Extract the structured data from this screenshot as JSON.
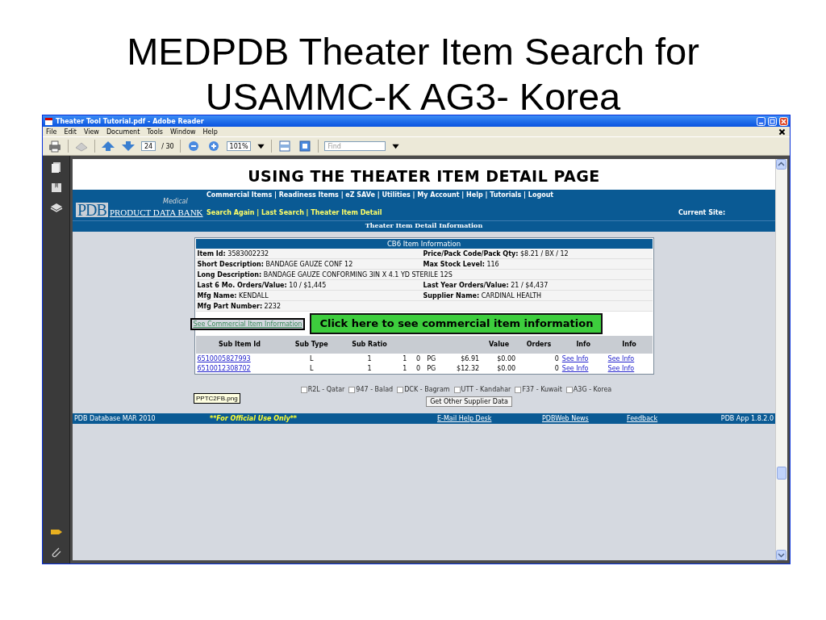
{
  "slide_title": "MEDPDB Theater Item Search for USAMMC-K AG3- Korea",
  "window": {
    "title": "Theater Tool Tutorial.pdf - Adobe Reader"
  },
  "menu": [
    "File",
    "Edit",
    "View",
    "Document",
    "Tools",
    "Window",
    "Help"
  ],
  "toolbar": {
    "page": "24",
    "page_count": "/ 30",
    "zoom": "101%",
    "find_placeholder": "Find"
  },
  "document": {
    "heading": "USING THE THEATER ITEM DETAIL PAGE",
    "logo": {
      "mark": "PDB",
      "name": "PRODUCT DATA BANK",
      "tag": "Medical"
    },
    "nav": "Commercial Items | Readiness Items | eZ SAVe | Utilities | My Account | Help | Tutorials | Logout",
    "subnav": "Search Again | Last Search | Theater Item Detail",
    "current_site": "Current Site:",
    "section_title": "Theater Item Detail Information",
    "info": {
      "title": "CB6 Item Information",
      "rows": [
        {
          "fields": [
            "**Item Id:** 3583002232",
            "**Price/Pack Code/Pack Qty:** $8.21 / BX / 12"
          ]
        },
        {
          "fields": [
            "**Short Description:** BANDAGE GAUZE CONF 12",
            "**Max Stock Level:** 116"
          ]
        },
        {
          "fields": [
            "**Long Description:** BANDAGE GAUZE CONFORMING 3IN X 4.1 YD STERILE 12S"
          ]
        },
        {
          "fields": [
            "**Last 6 Mo. Orders/Value:** 10 / $1,445",
            "**Last Year Orders/Value:** 21 / $4,437"
          ]
        },
        {
          "fields": [
            "**Mfg Name:** KENDALL",
            "**Supplier Name:** CARDINAL HEALTH"
          ]
        },
        {
          "fields": [
            "**Mfg Part Number:** 2232"
          ]
        }
      ],
      "link": "See Commercial Item Information",
      "columns": [
        {
          "label": "Sub Item Id",
          "kind": "link"
        },
        {
          "label": "Sub Type",
          "kind": "center"
        },
        {
          "label": "Sub Ratio",
          "kind": "center"
        },
        {
          "kind": "center"
        },
        {
          "kind": "number"
        },
        {
          "kind": "center"
        },
        {
          "kind": "number"
        },
        {
          "label": "Value",
          "kind": "number"
        },
        {
          "label": "Orders",
          "kind": "number"
        },
        {
          "label": "Info",
          "kind": "link"
        },
        {
          "label": "Info",
          "kind": "link"
        }
      ],
      "table_rows": [
        [
          "6510005827993",
          "L",
          "1",
          "1",
          "0",
          "PG",
          "$6.91",
          "$0.00",
          "0",
          "See Info",
          "See Info"
        ],
        [
          "6510012308702",
          "L",
          "1",
          "1",
          "0",
          "PG",
          "$12.32",
          "$0.00",
          "0",
          "See Info",
          "See Info"
        ]
      ]
    },
    "callout": "Click here to see commercial item information",
    "sites": [
      {
        "label": "R2L - Qatar",
        "checked": false
      },
      {
        "label": "947 - Balad",
        "checked": false
      },
      {
        "label": "DCK - Bagram",
        "checked": false
      },
      {
        "label": "UTT - Kandahar",
        "checked": false
      },
      {
        "label": "F37 - Kuwait",
        "checked": false
      },
      {
        "label": "A3G - Korea",
        "checked": false
      }
    ],
    "button": "Get Other Supplier Data",
    "tooltip": "PPTC2FB.png",
    "footer": [
      {
        "text": "PDB Database MAR 2010",
        "kind": "text"
      },
      {
        "text": "**For Official Use Only**",
        "kind": "notice"
      },
      {
        "text": "E-Mail Help Desk",
        "kind": "link"
      },
      {
        "text": "PDBWeb News",
        "kind": "link"
      },
      {
        "text": "Feedback",
        "kind": "link"
      },
      {
        "text": "PDB App 1.8.2.0",
        "kind": "text"
      }
    ]
  }
}
